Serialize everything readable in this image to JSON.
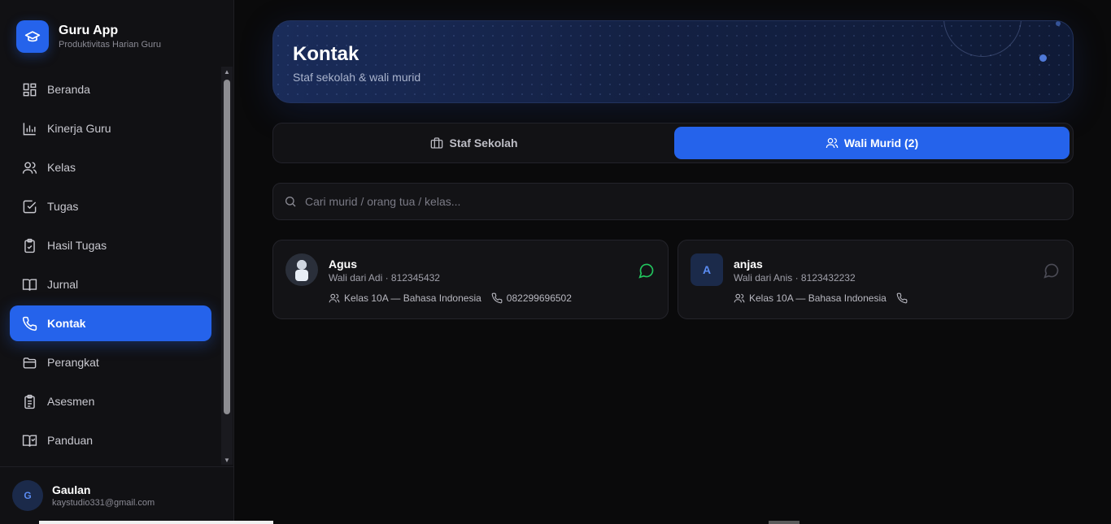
{
  "brand": {
    "title": "Guru App",
    "subtitle": "Produktivitas Harian Guru"
  },
  "sidebar": {
    "items": [
      {
        "label": "Beranda",
        "icon": "dashboard-icon",
        "active": false
      },
      {
        "label": "Kinerja Guru",
        "icon": "bar-chart-icon",
        "active": false
      },
      {
        "label": "Kelas",
        "icon": "users-icon",
        "active": false
      },
      {
        "label": "Tugas",
        "icon": "checkbox-icon",
        "active": false
      },
      {
        "label": "Hasil Tugas",
        "icon": "clipboard-check-icon",
        "active": false
      },
      {
        "label": "Jurnal",
        "icon": "book-open-icon",
        "active": false
      },
      {
        "label": "Kontak",
        "icon": "phone-icon",
        "active": true
      },
      {
        "label": "Perangkat",
        "icon": "folder-icon",
        "active": false
      },
      {
        "label": "Asesmen",
        "icon": "clipboard-list-icon",
        "active": false
      },
      {
        "label": "Panduan",
        "icon": "book-check-icon",
        "active": false
      }
    ]
  },
  "user": {
    "initial": "G",
    "name": "Gaulan",
    "email": "kaystudio331@gmail.com"
  },
  "hero": {
    "title": "Kontak",
    "subtitle": "Staf sekolah & wali murid"
  },
  "tabs": [
    {
      "label": "Staf Sekolah",
      "icon": "briefcase-icon",
      "active": false
    },
    {
      "label": "Wali Murid (2)",
      "icon": "users-icon",
      "active": true
    }
  ],
  "search": {
    "placeholder": "Cari murid / orang tua / kelas..."
  },
  "contacts": [
    {
      "name": "Agus",
      "sub": "Wali dari Adi · 812345432",
      "class": "Kelas 10A — Bahasa Indonesia",
      "phone": "082299696502",
      "avatar": "photo",
      "chat_color": "#22c55e"
    },
    {
      "name": "anjas",
      "sub": "Wali dari Anis · 8123432232",
      "class": "Kelas 10A — Bahasa Indonesia",
      "phone": "",
      "avatar_letter": "A",
      "chat_color": "#4b4b55"
    }
  ],
  "colors": {
    "accent": "#2563eb",
    "sidebar_bg": "#111114",
    "main_bg": "#0a0a0b"
  }
}
